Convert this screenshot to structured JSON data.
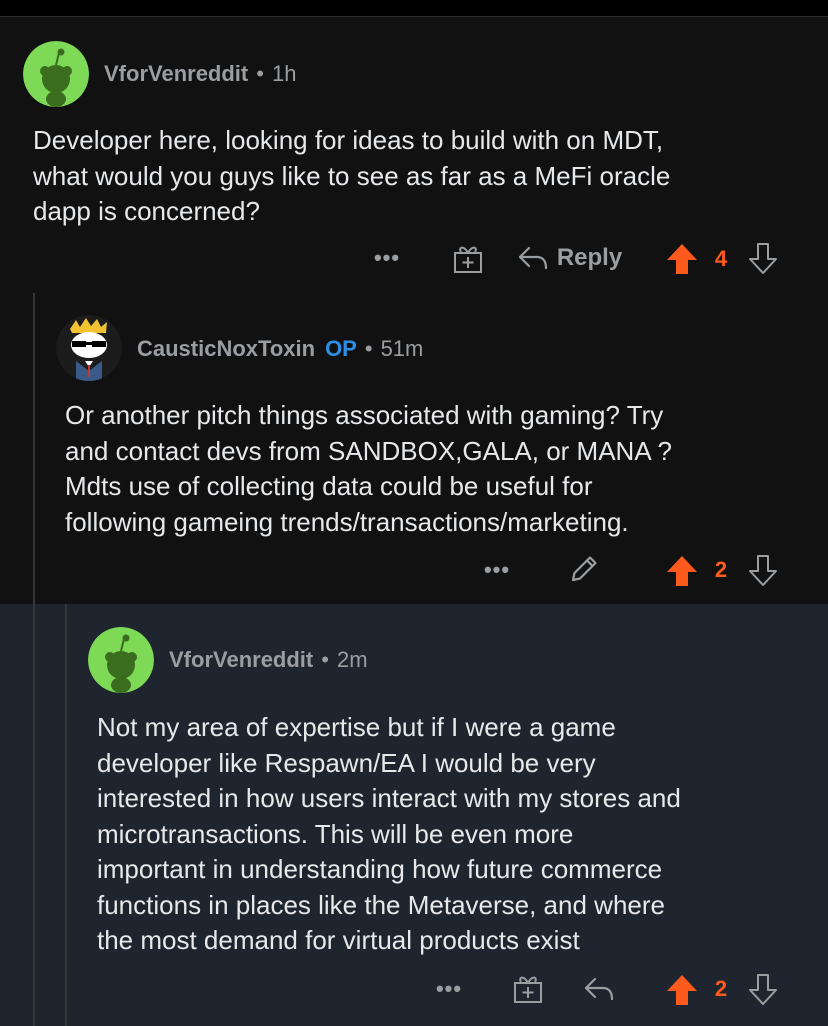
{
  "colors": {
    "background": "#111112",
    "highlight_background": "#1f252f",
    "username": "#9b9ea1",
    "op_badge": "#2d8fe6",
    "upvote": "#ff5a1e",
    "avatar_green": "#7ed957"
  },
  "comments": [
    {
      "author": "VforVenreddit",
      "separator": "•",
      "age": "1h",
      "body": "Developer here, looking for ideas to build with on MDT,\nwhat would you guys like to see as far as a MeFi oracle\ndapp is concerned?",
      "actions": {
        "more": "•••",
        "award_icon": "gift-icon",
        "reply_label": "Reply",
        "upvote_icon": "upvote-arrow-icon",
        "votes": "4",
        "downvote_icon": "downvote-arrow-icon"
      }
    },
    {
      "author": "CausticNoxToxin",
      "op_badge": "OP",
      "separator": "•",
      "age": "51m",
      "body": "Or another pitch things associated with gaming? Try\nand contact devs from SANDBOX,GALA, or MANA ?\nMdts use of collecting data could be useful for\nfollowing gameing trends/transactions/marketing.",
      "actions": {
        "more": "•••",
        "edit_icon": "pencil-icon",
        "upvote_icon": "upvote-arrow-icon",
        "votes": "2",
        "downvote_icon": "downvote-arrow-icon"
      }
    },
    {
      "author": "VforVenreddit",
      "separator": "•",
      "age": "2m",
      "body": "Not my area of expertise but if I were a game\ndeveloper like Respawn/EA I would be very\ninterested in how users interact with my stores and\nmicrotransactions. This will be even more\nimportant in understanding how future commerce\nfunctions in places like the Metaverse, and where\nthe most demand for virtual products exist",
      "actions": {
        "more": "•••",
        "award_icon": "gift-icon",
        "reply_icon": "reply-arrow-icon",
        "upvote_icon": "upvote-arrow-icon",
        "votes": "2",
        "downvote_icon": "downvote-arrow-icon"
      }
    }
  ]
}
